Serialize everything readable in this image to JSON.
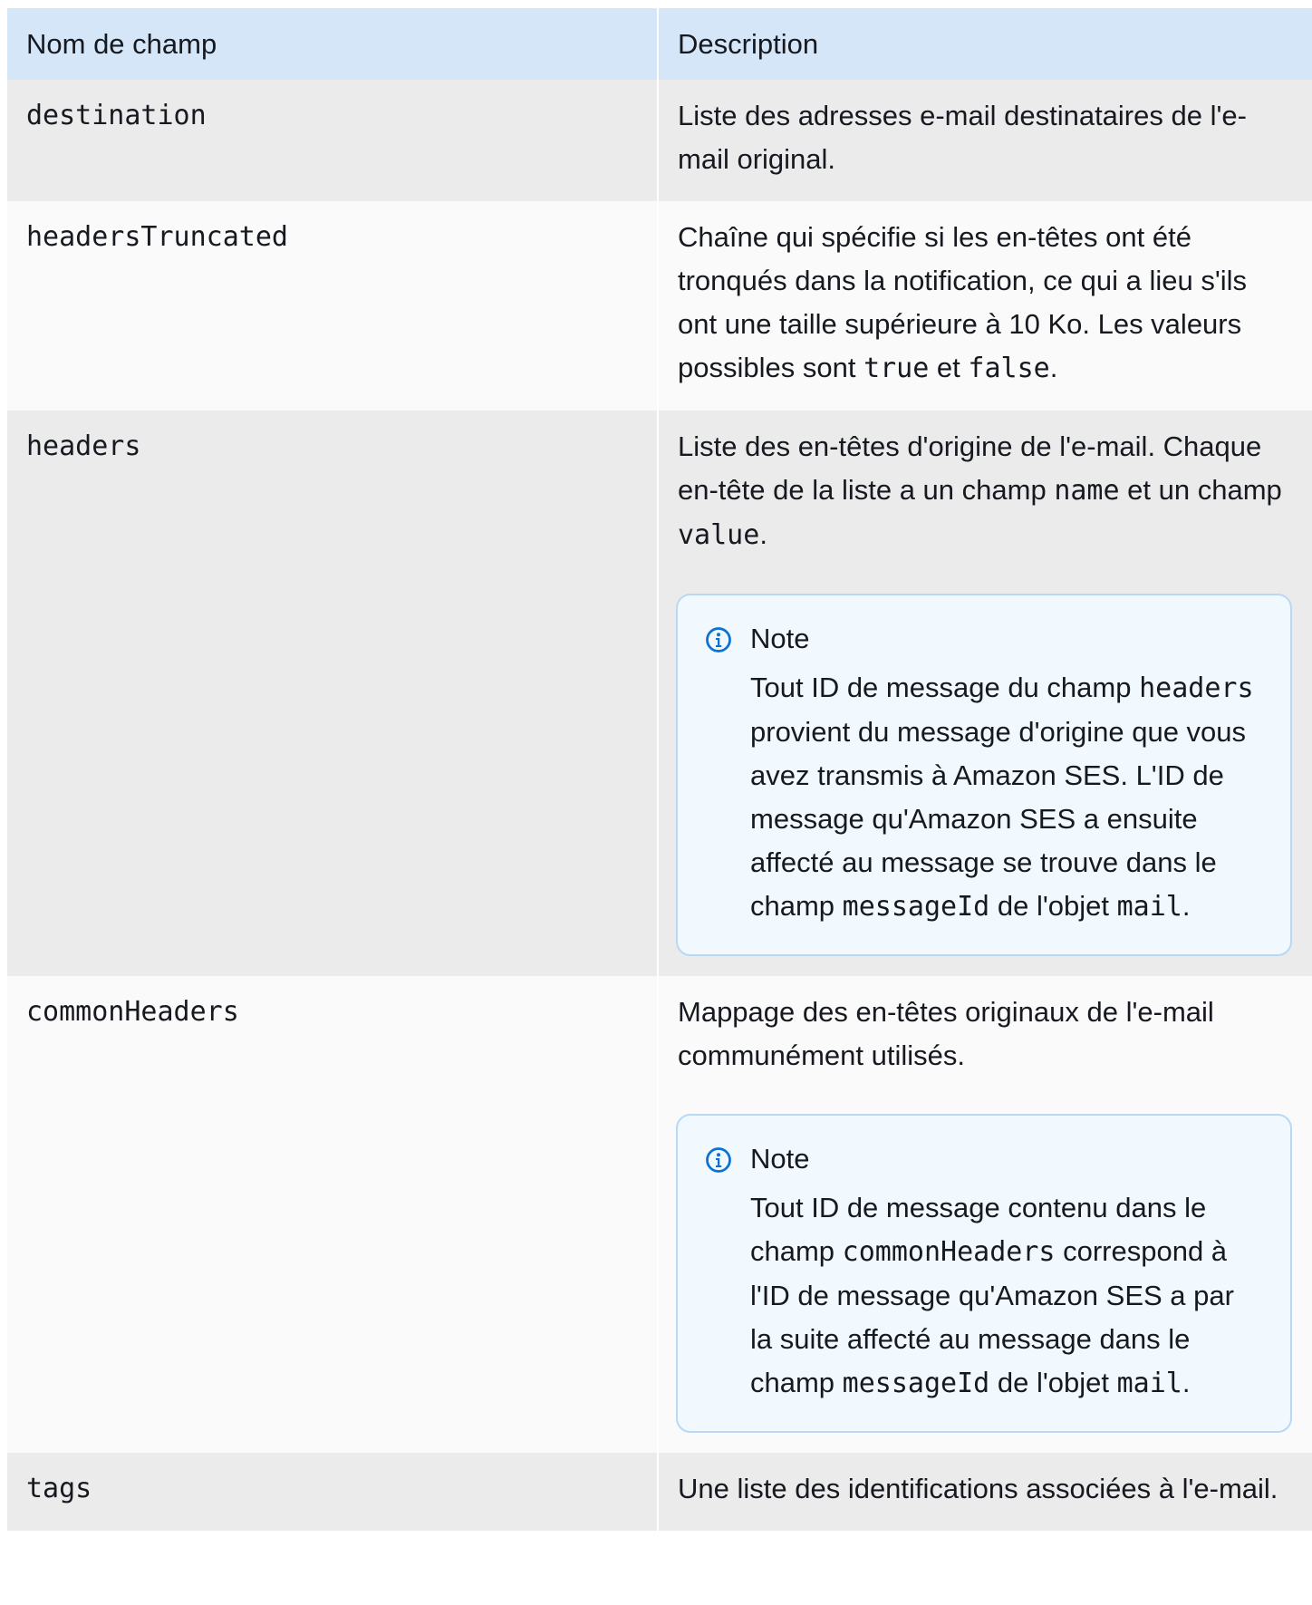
{
  "table": {
    "headers": [
      "Nom de champ",
      "Description"
    ],
    "rows": [
      {
        "field": "destination",
        "desc": [
          "Liste des adresses e-mail destinataires de l'e-mail original."
        ]
      },
      {
        "field": "headersTruncated",
        "desc": [
          "Chaîne qui spécifie si les en-têtes ont été tronqués dans la notification, ce qui a lieu s'ils ont une taille supérieure à 10 Ko. Les valeurs possibles sont ",
          "true",
          " et ",
          "false",
          "."
        ]
      },
      {
        "field": "headers",
        "desc": [
          "Liste des en-têtes d'origine de l'e-mail. Chaque en-tête de la liste a un champ ",
          "name",
          " et un champ ",
          "value",
          "."
        ],
        "note": {
          "title": "Note",
          "body": [
            "Tout ID de message du champ ",
            "headers",
            " provient du message d'origine que vous avez transmis à Amazon SES. L'ID de message qu'Amazon SES a ensuite affecté au message se trouve dans le champ ",
            "messageId",
            " de l'objet ",
            "mail",
            "."
          ]
        }
      },
      {
        "field": "commonHeaders",
        "desc": [
          "Mappage des en-têtes originaux de l'e-mail communément utilisés."
        ],
        "note": {
          "title": "Note",
          "body": [
            "Tout ID de message contenu dans le champ ",
            "commonHeaders",
            " correspond à l'ID de message qu'Amazon SES a par la suite affecté au message dans le champ ",
            "messageId",
            " de l'objet ",
            "mail",
            "."
          ]
        }
      },
      {
        "field": "tags",
        "desc": [
          "Une liste des identifications associées à l'e-mail."
        ]
      }
    ]
  },
  "icons": {
    "note": "info-circle-icon",
    "color": "#0972d3"
  }
}
